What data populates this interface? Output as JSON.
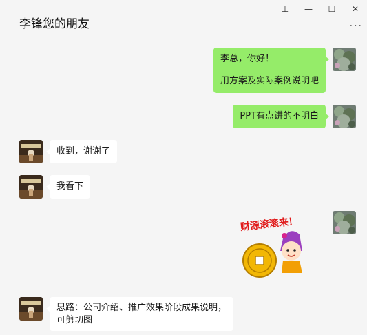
{
  "window": {
    "title": "李锋您的朋友",
    "pin_glyph": "⊥",
    "minimize_glyph": "—",
    "maximize_glyph": "☐",
    "close_glyph": "✕",
    "more_glyph": "···"
  },
  "messages": [
    {
      "side": "out",
      "lines": [
        "李总，你好！",
        "用方案及实际案例说明吧"
      ]
    },
    {
      "side": "out",
      "lines": [
        "PPT有点讲的不明白"
      ]
    },
    {
      "side": "in",
      "lines": [
        "收到，谢谢了"
      ]
    },
    {
      "side": "in",
      "lines": [
        "我看下"
      ]
    },
    {
      "side": "out",
      "sticker_text": "财源滚滚来！"
    },
    {
      "side": "in",
      "lines": [
        "思路：公司介绍、推广效果阶段成果说明，",
        "可剪切图"
      ]
    }
  ],
  "colors": {
    "background": "#f5f5f5",
    "outgoing_bubble": "#95ec69",
    "incoming_bubble": "#ffffff"
  },
  "icons": {
    "self_avatar": "plant-photo-avatar",
    "contact_avatar": "figure-photo-avatar",
    "sticker": "cartoon-girl-with-gold-coin"
  }
}
